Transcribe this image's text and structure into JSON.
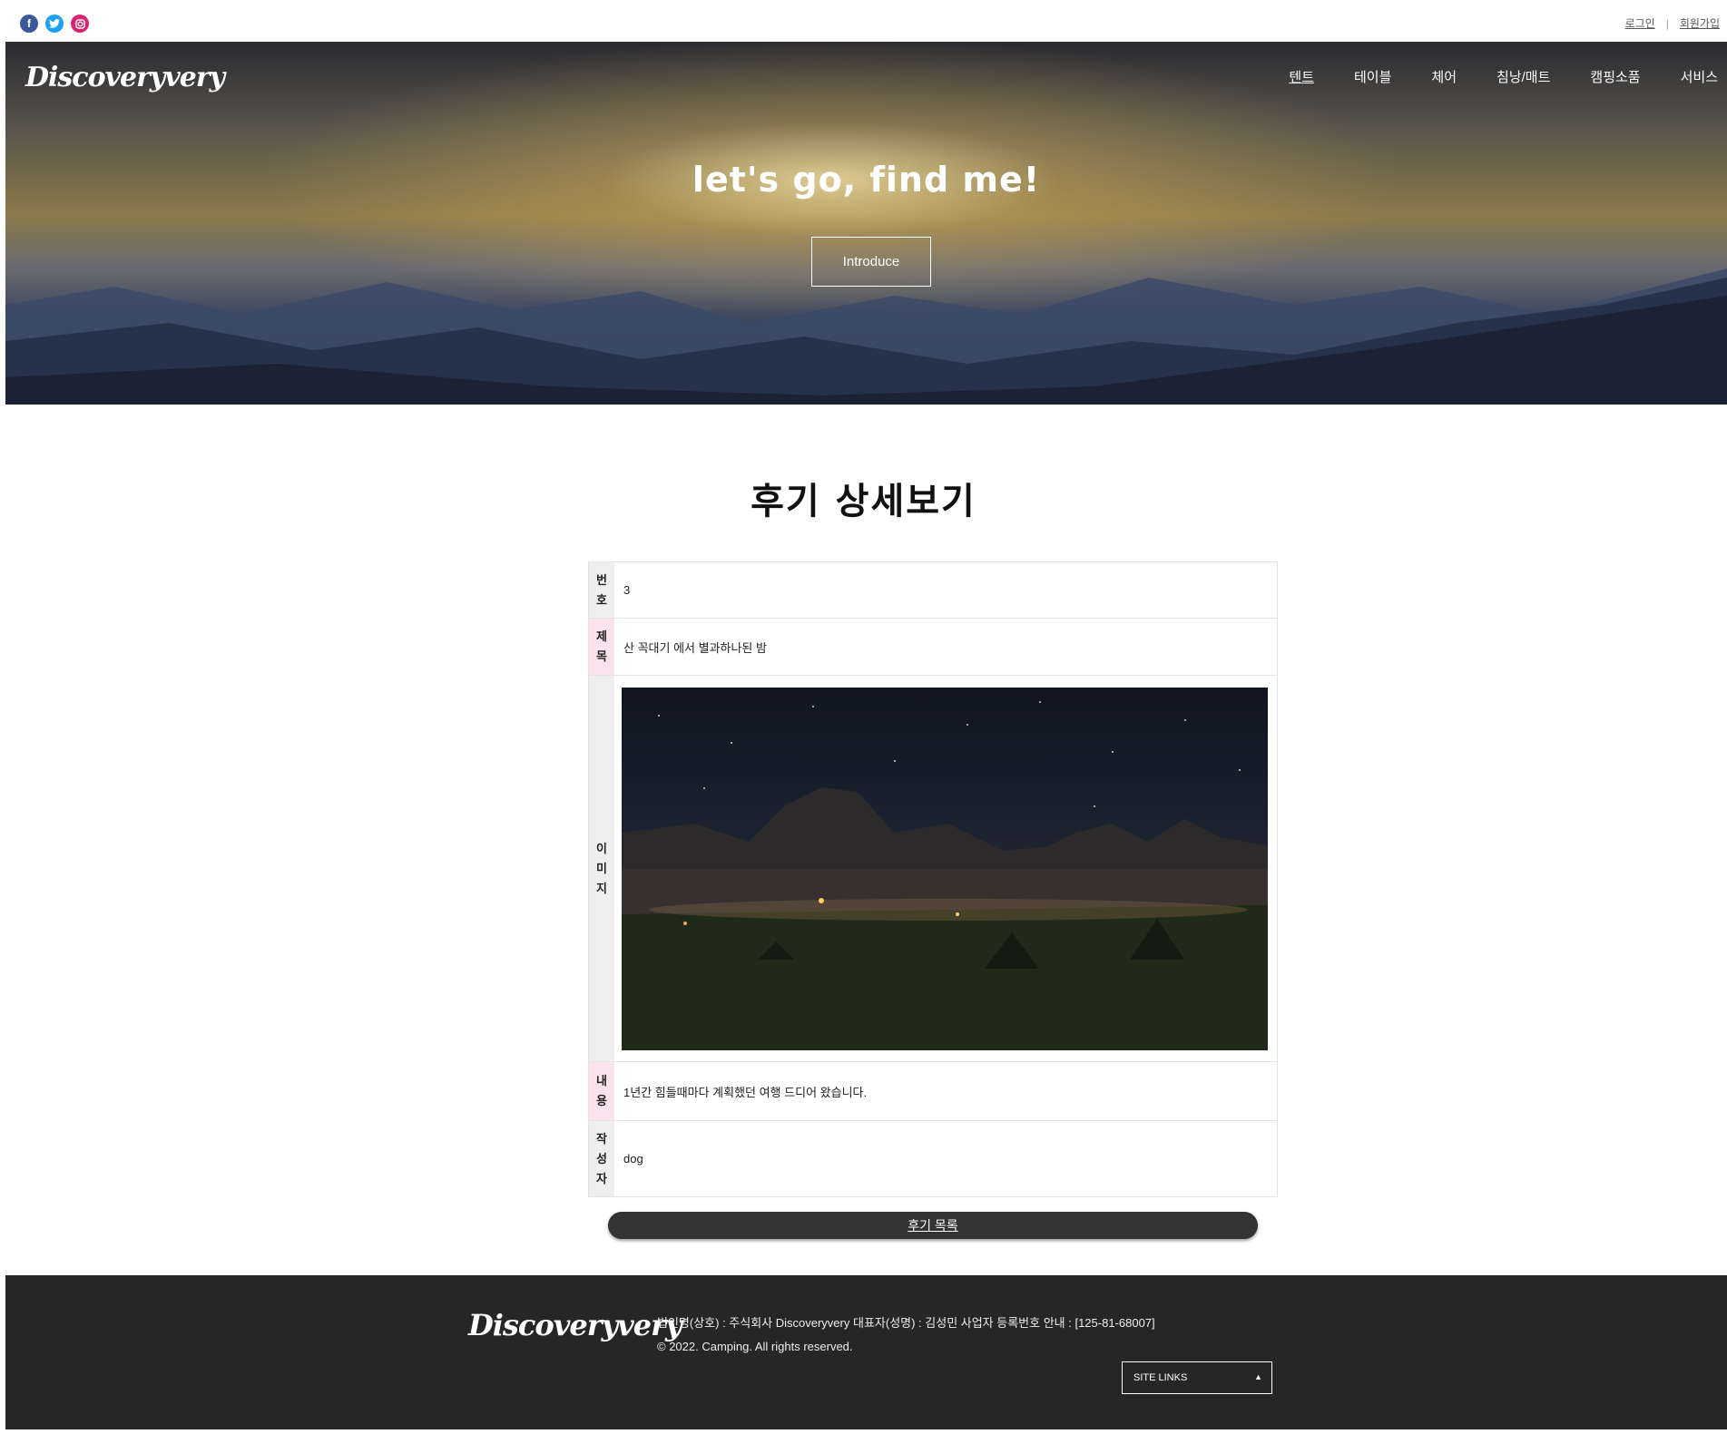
{
  "header": {
    "social_icons": [
      "facebook-icon",
      "twitter-icon",
      "instagram-icon"
    ],
    "login": "로그인",
    "signup": "회원가입"
  },
  "hero": {
    "logo": "Discoveryvery",
    "nav": [
      "텐트",
      "테이블",
      "체어",
      "침낭/매트",
      "캠핑소품",
      "서비스"
    ],
    "title": "let's go, find me!",
    "button": "Introduce"
  },
  "page": {
    "title": "후기 상세보기"
  },
  "review": {
    "labels": {
      "number": "번\n호",
      "title": "제\n목",
      "image": "이\n미\n지",
      "content": "내\n용",
      "writer": "작\n성\n자"
    },
    "number": "3",
    "title": "산 꼭대기 에서 별과하나된 밤",
    "content": "1년간 힘들때마다 계획했던 여행 드디어 왔습니다.",
    "writer": "dog"
  },
  "actions": {
    "back_to_list": "후기 목록"
  },
  "footer": {
    "logo": "Discoveryvery",
    "company": "법인명(상호) : 주식회사 Discoveryvery 대표자(성명) : 김성민 사업자 등록번호 안내 : [125-81-68007]",
    "copyright": "© 2022. Camping. All rights reserved.",
    "site_links": "SITE LINKS"
  },
  "colors": {
    "label_pink": "#fbe3ee",
    "label_gray": "#efefef",
    "footer_bg": "#262626",
    "button_dark": "#333333"
  }
}
